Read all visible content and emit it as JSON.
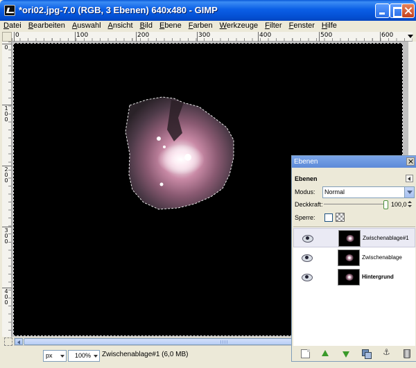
{
  "window": {
    "title": "*ori02.jpg-7.0 (RGB, 3 Ebenen) 640x480 - GIMP"
  },
  "menu": [
    "Datei",
    "Bearbeiten",
    "Auswahl",
    "Ansicht",
    "Bild",
    "Ebene",
    "Farben",
    "Werkzeuge",
    "Filter",
    "Fenster",
    "Hilfe"
  ],
  "rulers": {
    "horizontal": [
      "0",
      "100",
      "200",
      "300",
      "400",
      "500",
      "600"
    ],
    "vertical": [
      "0",
      "100",
      "200",
      "300",
      "400"
    ]
  },
  "status": {
    "unit": "px",
    "zoom": "100%",
    "text": "Zwischenablage#1 (6,0 MB)"
  },
  "dock": {
    "title": "Ebenen",
    "heading": "Ebenen",
    "mode_label": "Modus:",
    "mode_value": "Normal",
    "opacity_label": "Deckkraft:",
    "opacity_value": "100,0",
    "lock_label": "Sperre:",
    "layers": [
      {
        "name": "Zwischenablage#1",
        "visible": true,
        "selected": true,
        "bold": false
      },
      {
        "name": "Zwischenablage",
        "visible": true,
        "selected": false,
        "bold": false
      },
      {
        "name": "Hintergrund",
        "visible": true,
        "selected": false,
        "bold": true
      }
    ]
  },
  "icons": {
    "eye": "eye-icon",
    "new_layer": "new-layer-icon",
    "raise": "raise-layer-icon",
    "lower": "lower-layer-icon",
    "duplicate": "duplicate-layer-icon",
    "anchor": "anchor-layer-icon",
    "delete": "delete-layer-icon"
  }
}
